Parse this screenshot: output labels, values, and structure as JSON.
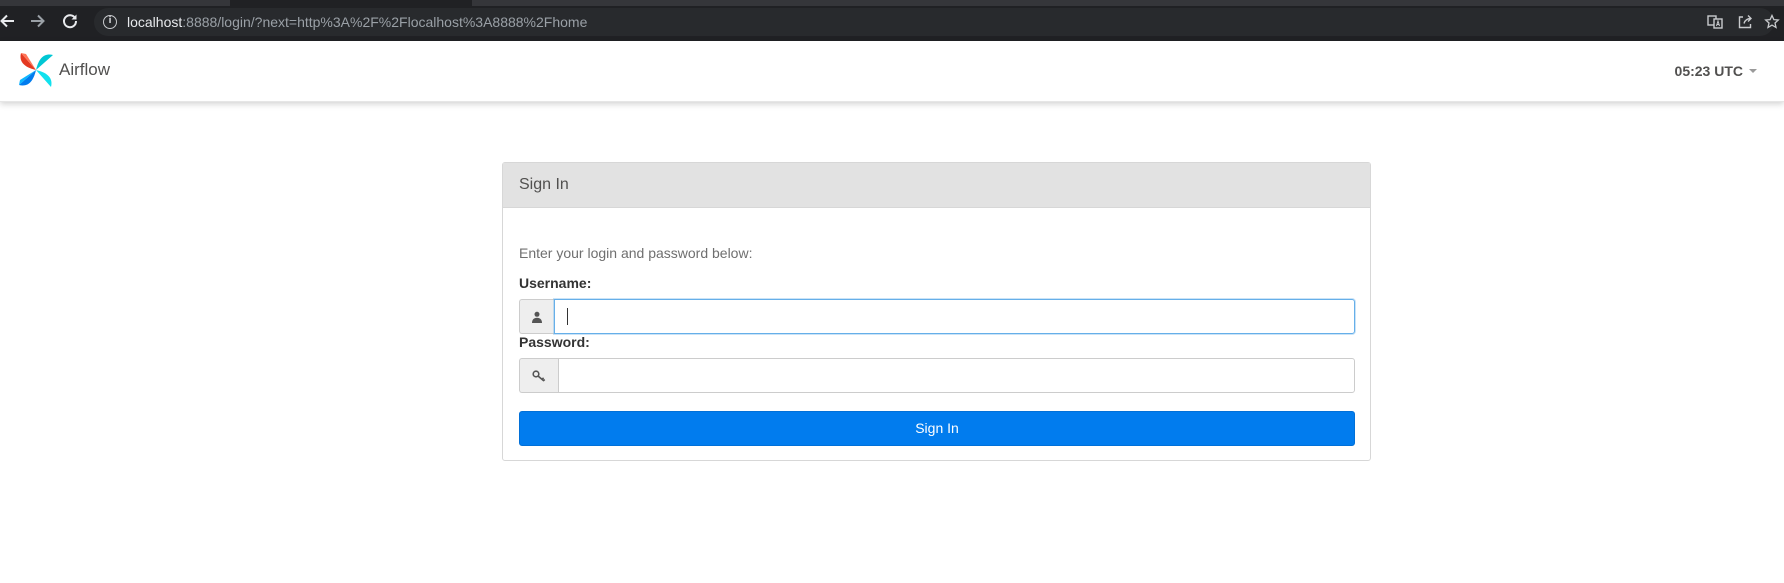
{
  "browser": {
    "url_host": "localhost",
    "url_rest": ":8888/login/?next=http%3A%2F%2Flocalhost%3A8888%2Fhome",
    "info_icon_glyph": "i",
    "icons": [
      "back-arrow-icon",
      "forward-arrow-icon",
      "reload-icon",
      "info-icon",
      "translate-icon",
      "share-icon",
      "bookmark-star-icon"
    ]
  },
  "navbar": {
    "brand_name": "Airflow",
    "clock": "05:23 UTC"
  },
  "login": {
    "title": "Sign In",
    "intro": "Enter your login and password below:",
    "username_label": "Username:",
    "username_value": "",
    "password_label": "Password:",
    "password_value": "",
    "submit_label": "Sign In"
  },
  "colors": {
    "browser_bar": "#202124",
    "panel_heading": "#e2e2e2",
    "primary_button": "#017cee",
    "focus_border": "#66afe9"
  }
}
